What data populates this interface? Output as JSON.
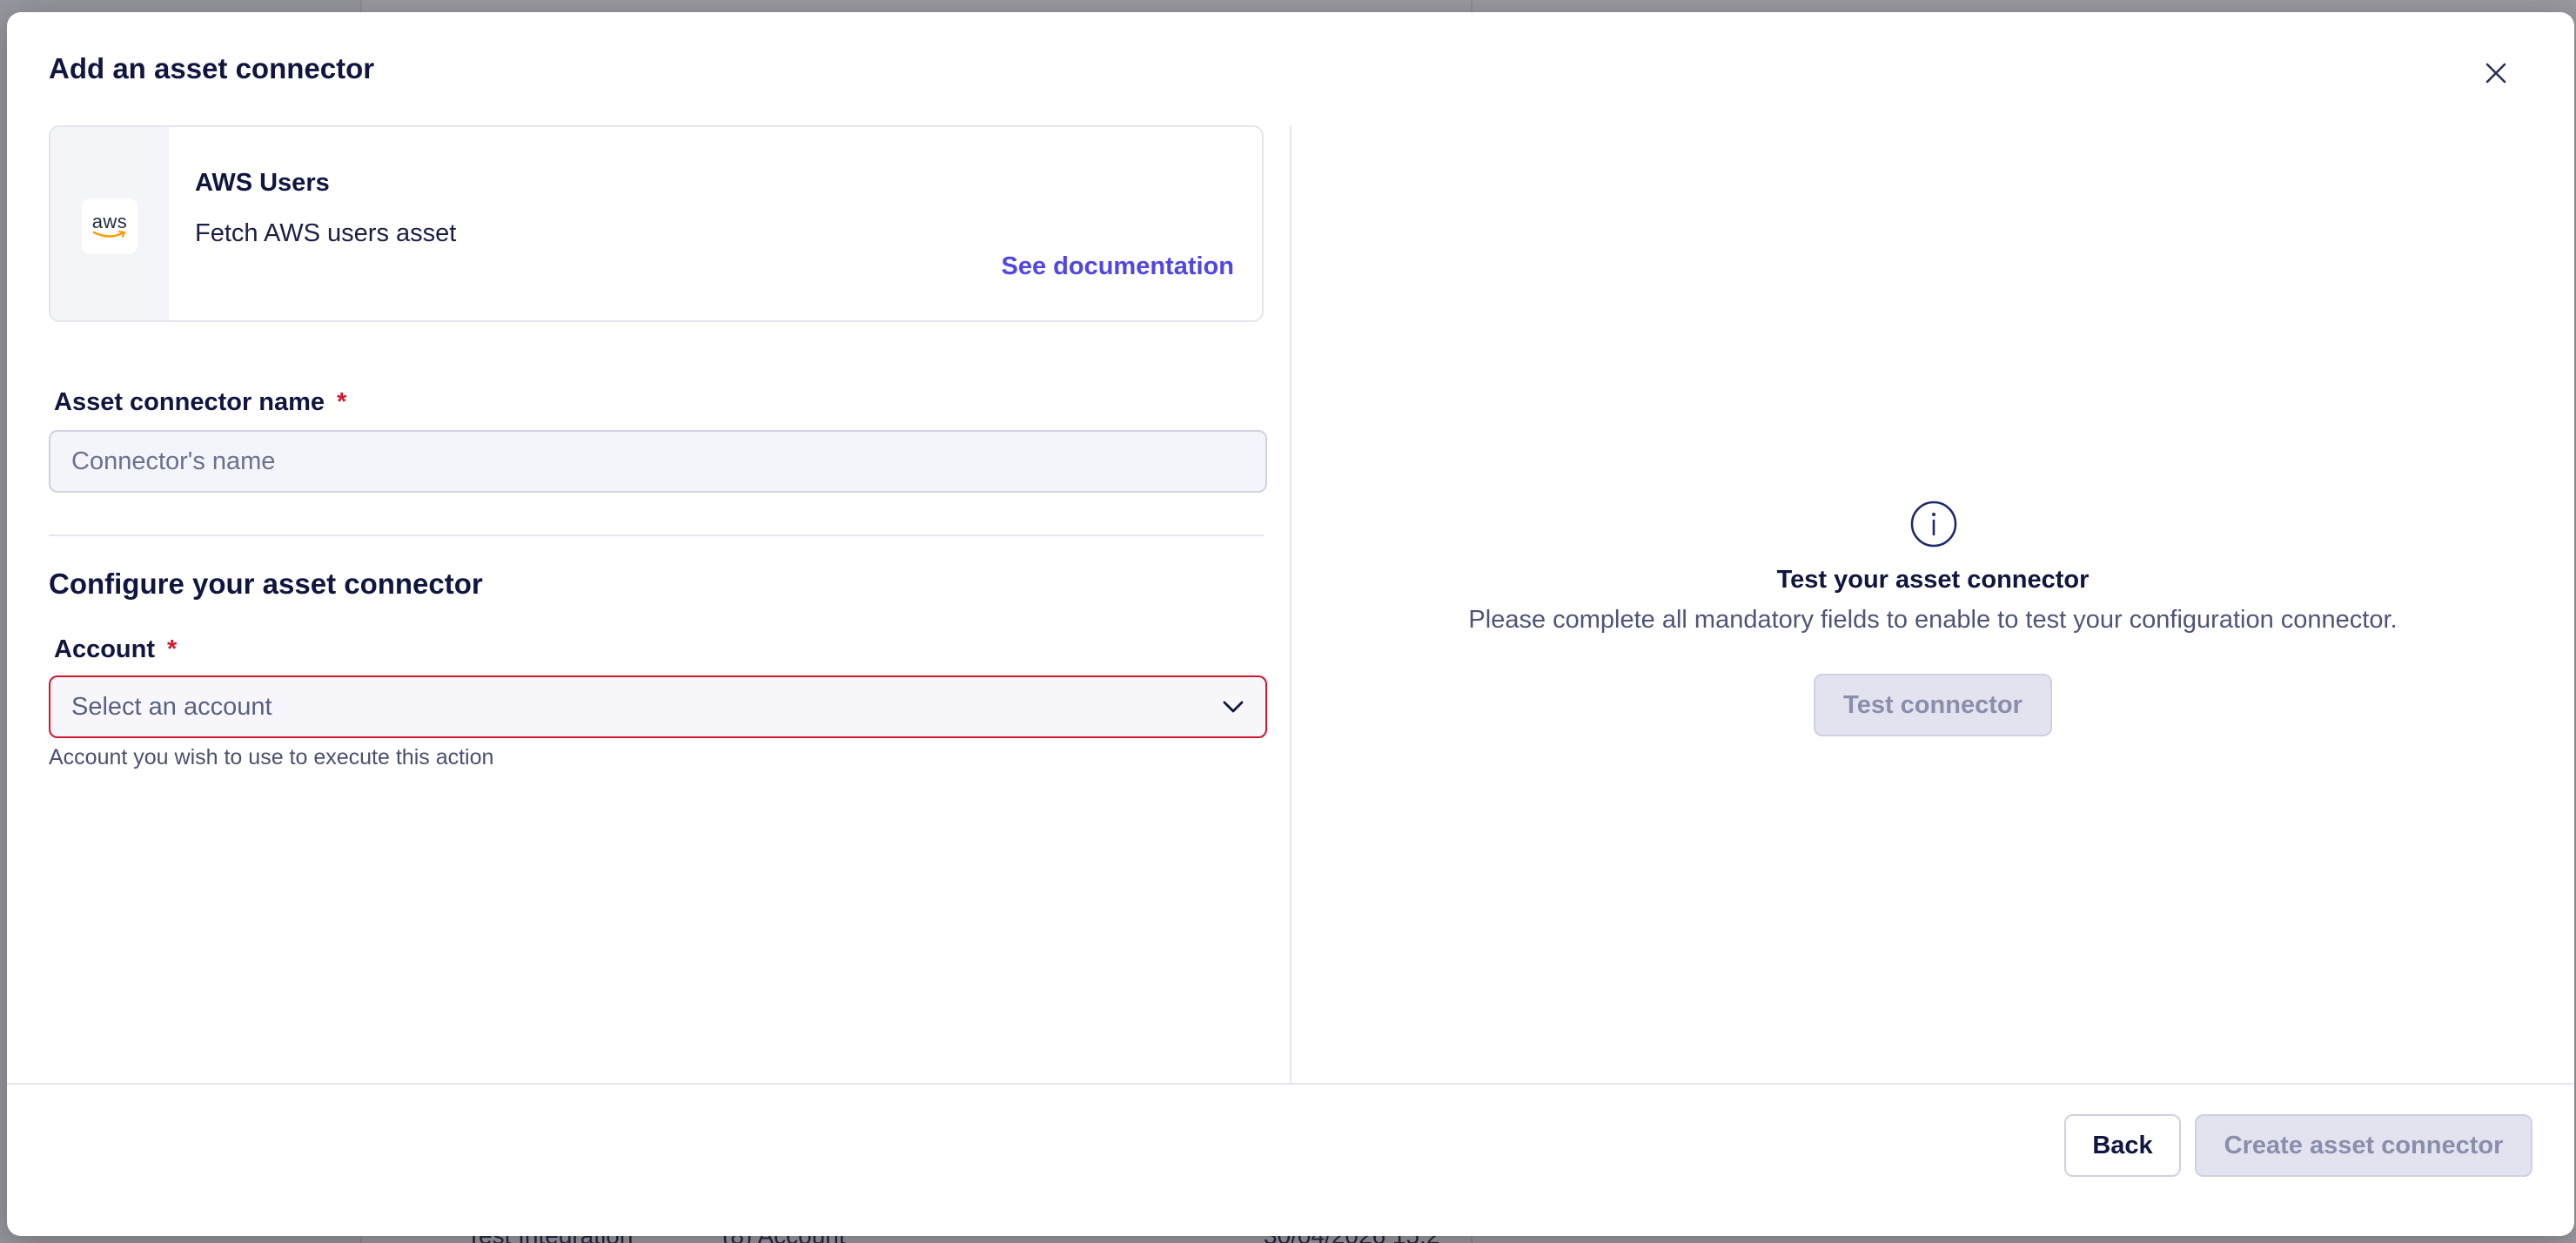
{
  "modal": {
    "title": "Add an asset connector",
    "close_icon": "close-icon"
  },
  "connector": {
    "logo_text": "aws",
    "logo_icon": "aws-logo-icon",
    "title": "AWS Users",
    "description": "Fetch AWS users asset",
    "doc_link": "See documentation"
  },
  "form": {
    "name_label": "Asset connector name",
    "required_mark": "*",
    "name_placeholder": "Connector's name",
    "name_value": "",
    "section_title": "Configure your asset connector",
    "account_label": "Account",
    "account_placeholder": "Select an account",
    "account_helper": "Account you wish to use to execute this action"
  },
  "test": {
    "info_icon": "info-icon",
    "title": "Test your asset connector",
    "description": "Please complete all mandatory fields to enable to test your configuration connector.",
    "button": "Test connector"
  },
  "footer": {
    "back": "Back",
    "create": "Create asset connector"
  },
  "background": {
    "row_col1": "Test Integration",
    "row_col2": "(8) Account",
    "row_col3": "30/04/2026 15:2"
  },
  "colors": {
    "accent": "#4f46e5",
    "error": "#d0182f",
    "heading": "#10163f"
  }
}
